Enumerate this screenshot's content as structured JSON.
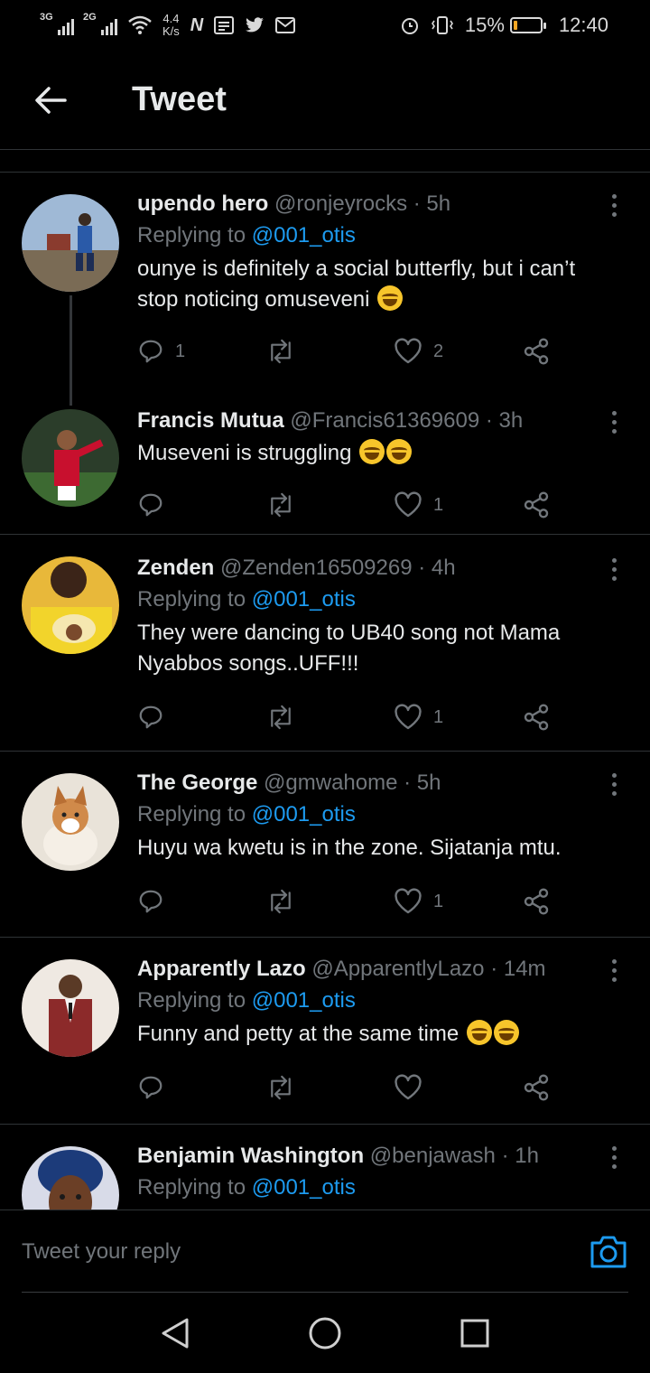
{
  "status_bar": {
    "signal_1": "3G",
    "signal_2": "2G",
    "speed_value": "4.4",
    "speed_unit": "K/s",
    "battery_percent": "15%",
    "battery_level": 0.15,
    "time": "12:40"
  },
  "header": {
    "title": "Tweet"
  },
  "tweets": [
    {
      "name": "upendo hero",
      "handle": "@ronjeyrocks",
      "time": "· 5h",
      "replying_prefix": "Replying to",
      "replying_to": "@001_otis",
      "text": "ounye is definitely a social butterfly, but i can’t stop noticing omuseveni",
      "replies": "1",
      "retweets": "",
      "likes": "2"
    },
    {
      "name": "Francis Mutua",
      "handle": "@Francis61369609",
      "time": "· 3h",
      "text": "Museveni is struggling",
      "replies": "",
      "retweets": "",
      "likes": "1"
    },
    {
      "name": "Zenden",
      "handle": "@Zenden16509269",
      "time": "· 4h",
      "replying_prefix": "Replying to",
      "replying_to": "@001_otis",
      "text": "They were dancing to UB40 song not Mama Nyabbos songs..UFF!!!",
      "replies": "",
      "retweets": "",
      "likes": "1"
    },
    {
      "name": "The George",
      "handle": "@gmwahome",
      "time": "· 5h",
      "replying_prefix": "Replying to",
      "replying_to": "@001_otis",
      "text": "Huyu wa kwetu is in the zone. Sijatanja mtu.",
      "replies": "",
      "retweets": "",
      "likes": "1"
    },
    {
      "name": "Apparently Lazo",
      "handle": "@ApparentlyLazo",
      "time": "· 14m",
      "replying_prefix": "Replying to",
      "replying_to": "@001_otis",
      "text": "Funny and petty at the same time",
      "replies": "",
      "retweets": "",
      "likes": ""
    },
    {
      "name": "Benjamin Washington",
      "handle": "@benjawash",
      "time": "· 1h",
      "replying_prefix": "Replying to",
      "replying_to": "@001_otis"
    }
  ],
  "composer": {
    "placeholder": "Tweet your reply"
  },
  "colors": {
    "accent": "#1d9bf0",
    "muted": "#71767b",
    "divider": "#2f3336",
    "background": "#000000"
  }
}
